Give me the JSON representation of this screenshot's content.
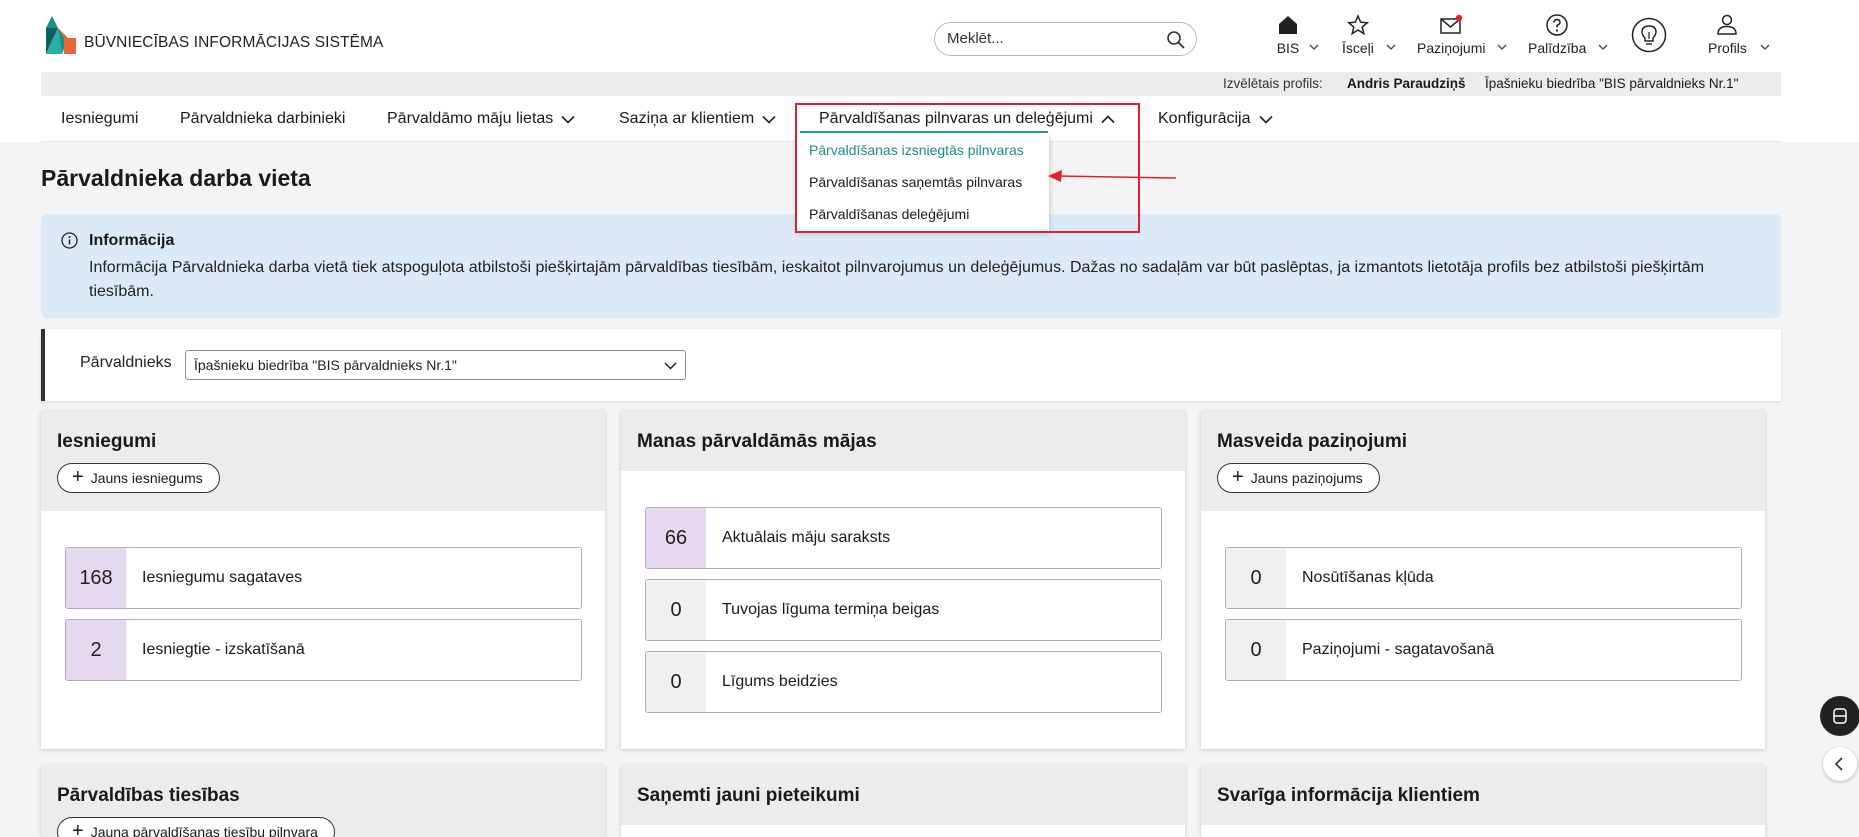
{
  "brand": {
    "name": "BŪVNIECĪBAS INFORMĀCIJAS SISTĒMA",
    "colors": {
      "teal": "#1a8f86",
      "orange": "#e8653a",
      "dark_teal": "#0f5e63"
    }
  },
  "search": {
    "placeholder": "Meklēt..."
  },
  "topnav": [
    {
      "label": "BIS",
      "icon": "home-icon"
    },
    {
      "label": "Īsceļi",
      "icon": "star-icon"
    },
    {
      "label": "Paziņojumi",
      "icon": "mail-icon"
    },
    {
      "label": "Palīdzība",
      "icon": "help-icon"
    },
    {
      "label": "",
      "icon": "lightbulb-icon"
    },
    {
      "label": "Profils",
      "icon": "user-icon"
    }
  ],
  "profile_bar": {
    "label": "Izvēlētais profils:",
    "user": "Andris Paraudziņš",
    "org": "Īpašnieku biedrība \"BIS pārvaldnieks Nr.1\""
  },
  "mainnav": [
    {
      "label": "Iesniegumi"
    },
    {
      "label": "Pārvaldnieka darbinieki"
    },
    {
      "label": "Pārvaldāmo māju lietas"
    },
    {
      "label": "Saziņa ar klientiem"
    },
    {
      "label": "Pārvaldīšanas pilnvaras un deleģējumi"
    },
    {
      "label": "Konfigurācija"
    }
  ],
  "dropdown": [
    {
      "label": "Pārvaldīšanas izsniegtās pilnvaras"
    },
    {
      "label": "Pārvaldīšanas saņemtās pilnvaras"
    },
    {
      "label": "Pārvaldīšanas deleģējumi"
    }
  ],
  "page_title": "Pārvaldnieka darba vieta",
  "info": {
    "title": "Informācija",
    "text": "Informācija Pārvaldnieka darba vietā tiek atspoguļota atbilstoši piešķirtajām pārvaldības tiesībām, ieskaitot pilnvarojumus un deleģējumus. Dažas no sadaļām var būt paslēptas, ja izmantots lietotāja profils bez atbilstoši piešķirtām tiesībām."
  },
  "manager": {
    "label": "Pārvaldnieks",
    "selected": "Īpašnieku biedrība \"BIS pārvaldnieks Nr.1\""
  },
  "cards": {
    "submissions": {
      "title": "Iesniegumi",
      "button": "Jauns iesniegums",
      "rows": [
        {
          "value": "168",
          "label": "Iesniegumu sagataves"
        },
        {
          "value": "2",
          "label": "Iesniegtie - izskatīšanā"
        }
      ]
    },
    "houses": {
      "title": "Manas pārvaldāmās mājas",
      "rows": [
        {
          "value": "66",
          "label": "Aktuālais māju saraksts"
        },
        {
          "value": "0",
          "label": "Tuvojas līguma termiņa beigas"
        },
        {
          "value": "0",
          "label": "Līgums beidzies"
        }
      ]
    },
    "notices": {
      "title": "Masveida paziņojumi",
      "button": "Jauns paziņojums",
      "rows": [
        {
          "value": "0",
          "label": "Nosūtīšanas kļūda"
        },
        {
          "value": "0",
          "label": "Paziņojumi - sagatavošanā"
        }
      ]
    },
    "rights": {
      "title": "Pārvaldības tiesības",
      "button": "Jauna pārvaldīšanas tiesību pilnvara"
    },
    "applications": {
      "title": "Saņemti jauni pieteikumi"
    },
    "client_info": {
      "title": "Svarīga informācija klientiem"
    }
  }
}
